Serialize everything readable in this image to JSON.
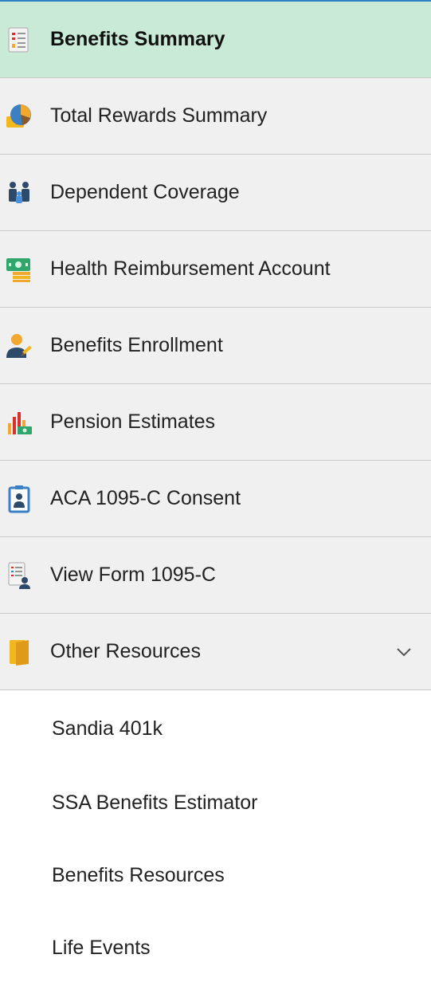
{
  "menu": {
    "items": [
      {
        "label": "Benefits Summary",
        "icon": "benefits-summary-icon",
        "active": true
      },
      {
        "label": "Total Rewards Summary",
        "icon": "total-rewards-icon"
      },
      {
        "label": "Dependent Coverage",
        "icon": "dependent-coverage-icon"
      },
      {
        "label": "Health Reimbursement Account",
        "icon": "health-reimbursement-icon"
      },
      {
        "label": "Benefits Enrollment",
        "icon": "benefits-enrollment-icon"
      },
      {
        "label": "Pension Estimates",
        "icon": "pension-estimates-icon"
      },
      {
        "label": "ACA 1095-C Consent",
        "icon": "aca-consent-icon"
      },
      {
        "label": "View Form 1095-C",
        "icon": "view-form-icon"
      },
      {
        "label": "Other Resources",
        "icon": "folder-icon",
        "expanded": true
      }
    ],
    "sub_items": [
      {
        "label": "Sandia 401k"
      },
      {
        "label": "SSA Benefits Estimator"
      },
      {
        "label": "Benefits Resources"
      },
      {
        "label": "Life Events"
      }
    ]
  },
  "colors": {
    "active_bg": "#c9ead6",
    "item_bg": "#f0f0f0",
    "top_border": "#2f7fc6"
  }
}
